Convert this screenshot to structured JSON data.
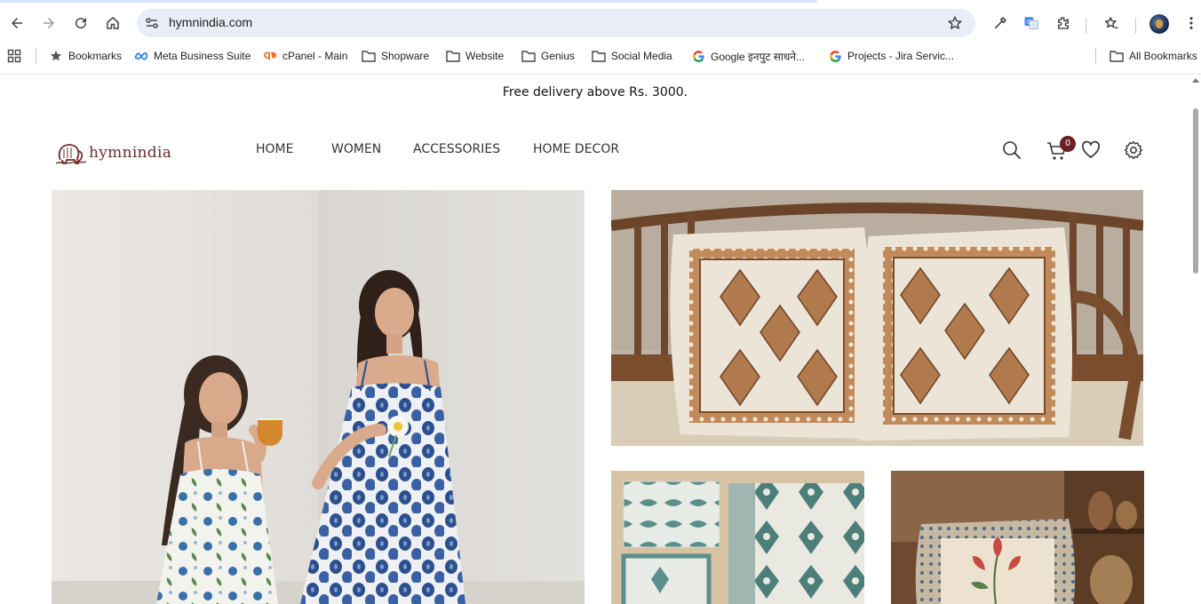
{
  "browser": {
    "url": "hymnindia.com",
    "bookmarks": [
      {
        "label": "Bookmarks",
        "icon": "star-icon"
      },
      {
        "label": "Meta Business Suite",
        "icon": "meta-icon"
      },
      {
        "label": "cPanel - Main",
        "icon": "cpanel-icon"
      },
      {
        "label": "Shopware",
        "icon": "folder-icon"
      },
      {
        "label": "Website",
        "icon": "folder-icon"
      },
      {
        "label": "Genius",
        "icon": "folder-icon"
      },
      {
        "label": "Social Media",
        "icon": "folder-icon"
      },
      {
        "label": "Google इनपुट साधने...",
        "icon": "google-icon"
      },
      {
        "label": "Projects - Jira Servic...",
        "icon": "google-icon"
      }
    ],
    "all_bookmarks": "All Bookmarks"
  },
  "site": {
    "announcement": "Free delivery above Rs. 3000.",
    "logo_text": "hymnindia",
    "nav": [
      "HOME",
      "WOMEN",
      "ACCESSORIES",
      "HOME DECOR"
    ],
    "cart_count": "0",
    "brand_color": "#6b1f22"
  }
}
